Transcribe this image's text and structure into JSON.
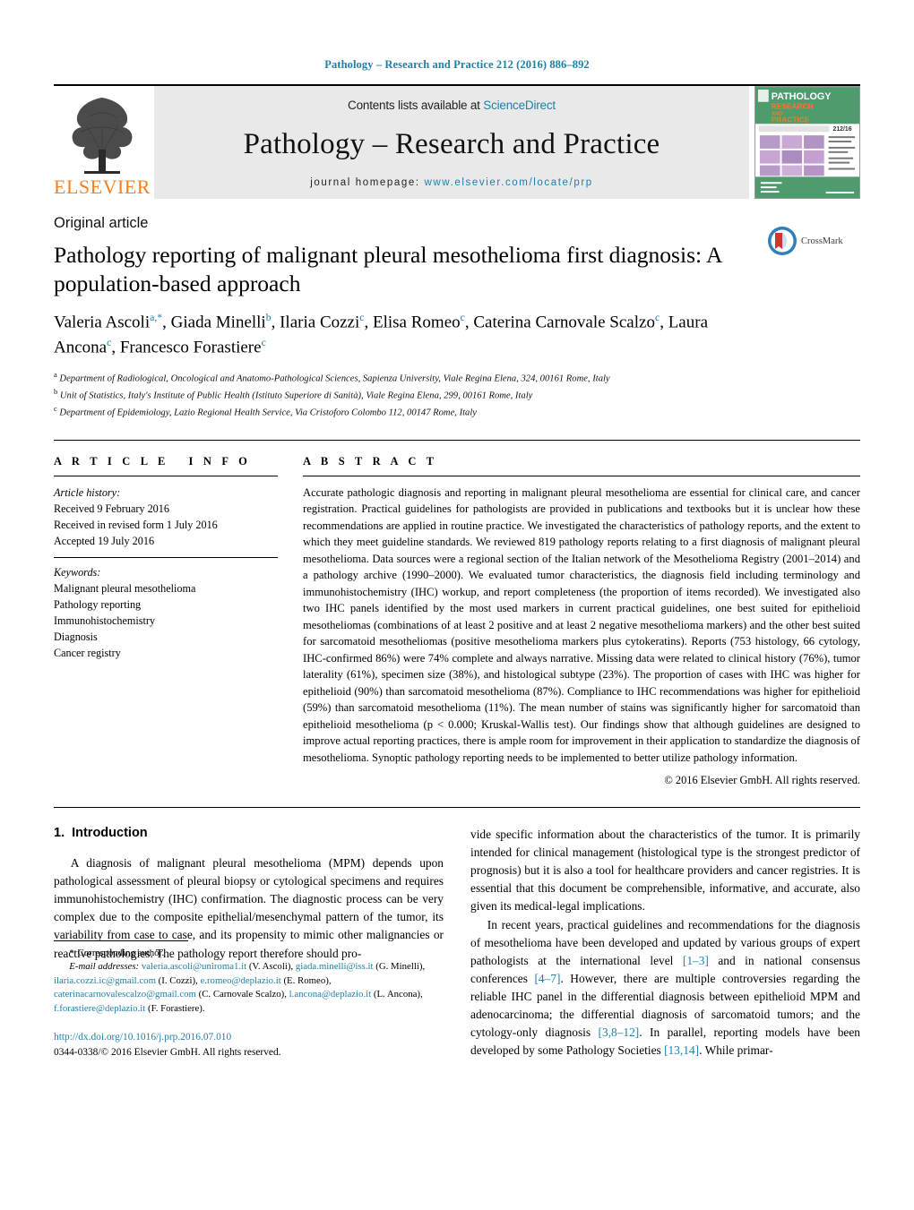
{
  "running_head": "Pathology – Research and Practice 212 (2016) 886–892",
  "masthead": {
    "publisher_name": "ELSEVIER",
    "contents_prefix": "Contents lists available at ",
    "contents_link": "ScienceDirect",
    "journal_title": "Pathology – Research and Practice",
    "homepage_prefix": "journal homepage: ",
    "homepage_url": "www.elsevier.com/locate/prp",
    "cover": {
      "line1": "PATHOLOGY",
      "line2": "RESEARCH",
      "line3": "AND",
      "line4": "PRACTICE",
      "issue": "212/16"
    }
  },
  "article": {
    "type": "Original article",
    "title": "Pathology reporting of malignant pleural mesothelioma first diagnosis: A population-based approach",
    "crossmark_label": "CrossMark",
    "authors": [
      {
        "name": "Valeria Ascoli",
        "marks": "a,*"
      },
      {
        "name": "Giada Minelli",
        "marks": "b"
      },
      {
        "name": "Ilaria Cozzi",
        "marks": "c"
      },
      {
        "name": "Elisa Romeo",
        "marks": "c"
      },
      {
        "name": "Caterina Carnovale Scalzo",
        "marks": "c"
      },
      {
        "name": "Laura Ancona",
        "marks": "c"
      },
      {
        "name": "Francesco Forastiere",
        "marks": "c"
      }
    ],
    "affiliations": [
      {
        "mark": "a",
        "text": "Department of Radiological, Oncological and Anatomo-Pathological Sciences, Sapienza University, Viale Regina Elena, 324, 00161 Rome, Italy"
      },
      {
        "mark": "b",
        "text": "Unit of Statistics, Italy's Institute of Public Health (Istituto Superiore di Sanità), Viale Regina Elena, 299, 00161 Rome, Italy"
      },
      {
        "mark": "c",
        "text": "Department of Epidemiology, Lazio Regional Health Service, Via Cristoforo Colombo 112, 00147 Rome, Italy"
      }
    ]
  },
  "article_info": {
    "heading": "ARTICLE INFO",
    "history_label": "Article history:",
    "history": [
      "Received 9 February 2016",
      "Received in revised form 1 July 2016",
      "Accepted 19 July 2016"
    ],
    "keywords_label": "Keywords:",
    "keywords": [
      "Malignant pleural mesothelioma",
      "Pathology reporting",
      "Immunohistochemistry",
      "Diagnosis",
      "Cancer registry"
    ]
  },
  "abstract": {
    "heading": "ABSTRACT",
    "text": "Accurate pathologic diagnosis and reporting in malignant pleural mesothelioma are essential for clinical care, and cancer registration. Practical guidelines for pathologists are provided in publications and textbooks but it is unclear how these recommendations are applied in routine practice. We investigated the characteristics of pathology reports, and the extent to which they meet guideline standards. We reviewed 819 pathology reports relating to a first diagnosis of malignant pleural mesothelioma. Data sources were a regional section of the Italian network of the Mesothelioma Registry (2001–2014) and a pathology archive (1990–2000). We evaluated tumor characteristics, the diagnosis field including terminology and immunohistochemistry (IHC) workup, and report completeness (the proportion of items recorded). We investigated also two IHC panels identified by the most used markers in current practical guidelines, one best suited for epithelioid mesotheliomas (combinations of at least 2 positive and at least 2 negative mesothelioma markers) and the other best suited for sarcomatoid mesotheliomas (positive mesothelioma markers plus cytokeratins). Reports (753 histology, 66 cytology, IHC-confirmed 86%) were 74% complete and always narrative. Missing data were related to clinical history (76%), tumor laterality (61%), specimen size (38%), and histological subtype (23%). The proportion of cases with IHC was higher for epithelioid (90%) than sarcomatoid mesothelioma (87%). Compliance to IHC recommendations was higher for epithelioid (59%) than sarcomatoid mesothelioma (11%). The mean number of stains was significantly higher for sarcomatoid than epithelioid mesothelioma (p < 0.000; Kruskal-Wallis test). Our findings show that although guidelines are designed to improve actual reporting practices, there is ample room for improvement in their application to standardize the diagnosis of mesothelioma. Synoptic pathology reporting needs to be implemented to better utilize pathology information.",
    "copyright": "© 2016 Elsevier GmbH. All rights reserved."
  },
  "introduction": {
    "number": "1.",
    "heading": "Introduction",
    "paragraph_1_left": "A diagnosis of malignant pleural mesothelioma (MPM) depends upon pathological assessment of pleural biopsy or cytological specimens and requires immunohistochemistry (IHC) confirmation. The diagnostic process can be very complex due to the composite epithelial/mesenchymal pattern of the tumor, its variability from case to case, and its propensity to mimic other malignancies or reactive pathologies. The pathology report therefore should pro-",
    "paragraph_1_right": "vide specific information about the characteristics of the tumor. It is primarily intended for clinical management (histological type is the strongest predictor of prognosis) but it is also a tool for healthcare providers and cancer registries. It is essential that this document be comprehensible, informative, and accurate, also given its medical-legal implications.",
    "paragraph_2_parts": [
      {
        "type": "text",
        "value": "In recent years, practical guidelines and recommendations for the diagnosis of mesothelioma have been developed and updated by various groups of expert pathologists at the international level "
      },
      {
        "type": "ref",
        "value": "[1–3]"
      },
      {
        "type": "text",
        "value": " and in national consensus conferences "
      },
      {
        "type": "ref",
        "value": "[4–7]"
      },
      {
        "type": "text",
        "value": ". However, there are multiple controversies regarding the reliable IHC panel in the differential diagnosis between epithelioid MPM and adenocarcinoma; the differential diagnosis of sarcomatoid tumors; and the cytology-only diagnosis "
      },
      {
        "type": "ref",
        "value": "[3,8–12]"
      },
      {
        "type": "text",
        "value": ". In parallel, reporting models have been developed by some Pathology Societies "
      },
      {
        "type": "ref",
        "value": "[13,14]"
      },
      {
        "type": "text",
        "value": ". While primar-"
      }
    ]
  },
  "footnotes": {
    "corresponding_star": "*",
    "corresponding_text": "Corresponding author.",
    "email_label": "E-mail addresses:",
    "emails": [
      {
        "address": "valeria.ascoli@uniroma1.it",
        "owner": "(V. Ascoli)"
      },
      {
        "address": "giada.minelli@iss.it",
        "owner": "(G. Minelli)"
      },
      {
        "address": "ilaria.cozzi.ic@gmail.com",
        "owner": "(I. Cozzi)"
      },
      {
        "address": "e.romeo@deplazio.it",
        "owner": "(E. Romeo)"
      },
      {
        "address": "caterinacarnovalescalzo@gmail.com",
        "owner": "(C. Carnovale Scalzo)"
      },
      {
        "address": "l.ancona@deplazio.it",
        "owner": "(L. Ancona)"
      },
      {
        "address": "f.forastiere@deplazio.it",
        "owner": "(F. Forastiere)"
      }
    ],
    "doi": "http://dx.doi.org/10.1016/j.prp.2016.07.010",
    "issn_line": "0344-0338/© 2016 Elsevier GmbH. All rights reserved."
  },
  "colors": {
    "link": "#1f7fa8",
    "elsevier_orange": "#F57F20",
    "masthead_gray": "#e9e9e9"
  }
}
